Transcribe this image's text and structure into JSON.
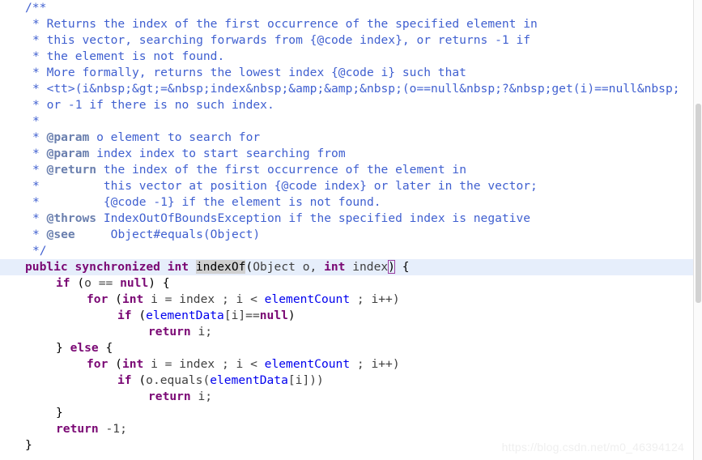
{
  "editor": {
    "language": "java",
    "background_color": "#ffffff",
    "current_line_highlight_color": "#e6eefb",
    "occurrence_highlight_color": "#d0d0d0",
    "bracket_match_outline_color": "#9b3fa0",
    "colors": {
      "comment": "#4060d0",
      "javadoc_tag": "#6a7fae",
      "keyword": "#7a0874",
      "field": "#0000ee",
      "identifier": "#404040"
    }
  },
  "watermark": {
    "text": "https://blog.csdn.net/m0_46394124"
  },
  "scrollbar": {
    "orientation": "vertical",
    "thumb_present": true
  },
  "code": {
    "lines": [
      {
        "indent": 0,
        "text": "/**"
      },
      {
        "indent": 1,
        "text": "* Returns the index of the first occurrence of the specified element in"
      },
      {
        "indent": 1,
        "text": "* this vector, searching forwards from {@code index}, or returns -1 if"
      },
      {
        "indent": 1,
        "text": "* the element is not found."
      },
      {
        "indent": 1,
        "text": "* More formally, returns the lowest index {@code i} such that"
      },
      {
        "indent": 1,
        "text": "* <tt>(i&nbsp;&gt;=&nbsp;index&nbsp;&amp;&amp;&nbsp;(o==null&nbsp;?&nbsp;get(i)==null&nbsp;"
      },
      {
        "indent": 1,
        "text": "* or -1 if there is no such index."
      },
      {
        "indent": 1,
        "text": "*"
      },
      {
        "indent": 1,
        "text": "* @param o element to search for"
      },
      {
        "indent": 1,
        "text": "* @param index index to start searching from"
      },
      {
        "indent": 1,
        "text": "* @return the index of the first occurrence of the element in"
      },
      {
        "indent": 1,
        "text": "*         this vector at position {@code index} or later in the vector;"
      },
      {
        "indent": 1,
        "text": "*         {@code -1} if the element is not found."
      },
      {
        "indent": 1,
        "text": "* @throws IndexOutOfBoundsException if the specified index is negative"
      },
      {
        "indent": 1,
        "text": "* @see     Object#equals(Object)"
      },
      {
        "indent": 1,
        "text": "*/"
      },
      {
        "indent": 0,
        "text": "public synchronized int indexOf(Object o, int index) {"
      },
      {
        "indent": 1,
        "text": "if (o == null) {"
      },
      {
        "indent": 2,
        "text": "for (int i = index ; i < elementCount ; i++)"
      },
      {
        "indent": 3,
        "text": "if (elementData[i]==null)"
      },
      {
        "indent": 4,
        "text": "return i;"
      },
      {
        "indent": 1,
        "text": "} else {"
      },
      {
        "indent": 2,
        "text": "for (int i = index ; i < elementCount ; i++)"
      },
      {
        "indent": 3,
        "text": "if (o.equals(elementData[i]))"
      },
      {
        "indent": 4,
        "text": "return i;"
      },
      {
        "indent": 2,
        "text": "}"
      },
      {
        "indent": 1,
        "text": "return -1;"
      },
      {
        "indent": 0,
        "text": "}"
      }
    ],
    "signature": {
      "modifiers": "public synchronized",
      "return_type": "int",
      "method_name": "indexOf",
      "parameters": "Object o, int index"
    },
    "javadoc_tags": [
      "@param",
      "@param",
      "@return",
      "@throws",
      "@see"
    ],
    "fields_referenced": [
      "elementCount",
      "elementData"
    ]
  }
}
